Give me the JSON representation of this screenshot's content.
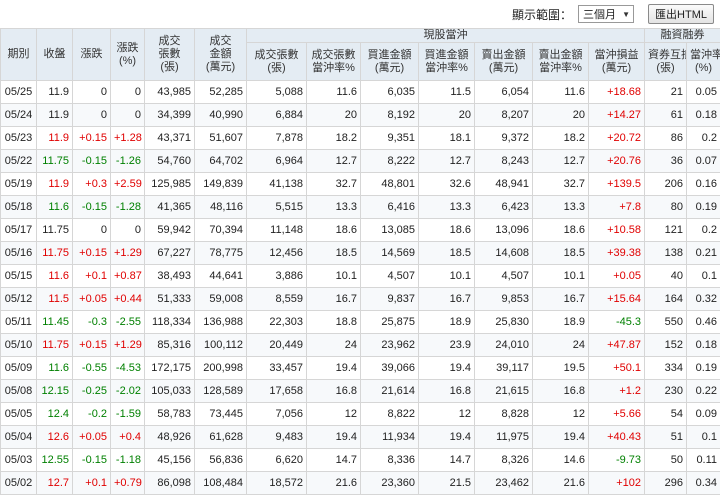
{
  "toolbar": {
    "range_label": "顯示範圍：",
    "range_value": "三個月",
    "export_label": "匯出HTML"
  },
  "colors": {
    "up": "#e00000",
    "down": "#008000",
    "header_bg": "#e4ecf3"
  },
  "groups": {
    "daytrade": "現股當沖",
    "margin": "融資融券"
  },
  "columns": {
    "date": "期別",
    "close": "收盤",
    "change": "漲跌",
    "pct": "漲跌(%)",
    "vol": "成交張數(張)",
    "amt": "成交金額(萬元)",
    "dt_vol": "成交張數(張)",
    "dt_vol_rate": "成交張數當沖率%",
    "buy_amt": "買進金額(萬元)",
    "buy_rate": "買進金額當沖率%",
    "sell_amt": "賣出金額(萬元)",
    "sell_rate": "賣出金額當沖率%",
    "pnl": "當沖損益(萬元)",
    "offset": "資券互抵(張)",
    "dt_rate": "當沖率(%)"
  },
  "rows": [
    {
      "date": "05/25",
      "close": "11.9",
      "change": "0",
      "pct": "0",
      "vol": "43,985",
      "amt": "52,285",
      "dt_vol": "5,088",
      "dt_vol_rate": "11.6",
      "buy_amt": "6,035",
      "buy_rate": "11.5",
      "sell_amt": "6,054",
      "sell_rate": "11.6",
      "pnl": "+18.68",
      "offset": "21",
      "dt_rate": "0.05",
      "dir": "flat",
      "pnl_dir": "pos"
    },
    {
      "date": "05/24",
      "close": "11.9",
      "change": "0",
      "pct": "0",
      "vol": "34,399",
      "amt": "40,990",
      "dt_vol": "6,884",
      "dt_vol_rate": "20",
      "buy_amt": "8,192",
      "buy_rate": "20",
      "sell_amt": "8,207",
      "sell_rate": "20",
      "pnl": "+14.27",
      "offset": "61",
      "dt_rate": "0.18",
      "dir": "flat",
      "pnl_dir": "pos"
    },
    {
      "date": "05/23",
      "close": "11.9",
      "change": "+0.15",
      "pct": "+1.28",
      "vol": "43,371",
      "amt": "51,607",
      "dt_vol": "7,878",
      "dt_vol_rate": "18.2",
      "buy_amt": "9,351",
      "buy_rate": "18.1",
      "sell_amt": "9,372",
      "sell_rate": "18.2",
      "pnl": "+20.72",
      "offset": "86",
      "dt_rate": "0.2",
      "dir": "pos",
      "pnl_dir": "pos"
    },
    {
      "date": "05/22",
      "close": "11.75",
      "change": "-0.15",
      "pct": "-1.26",
      "vol": "54,760",
      "amt": "64,702",
      "dt_vol": "6,964",
      "dt_vol_rate": "12.7",
      "buy_amt": "8,222",
      "buy_rate": "12.7",
      "sell_amt": "8,243",
      "sell_rate": "12.7",
      "pnl": "+20.76",
      "offset": "36",
      "dt_rate": "0.07",
      "dir": "neg",
      "pnl_dir": "pos"
    },
    {
      "date": "05/19",
      "close": "11.9",
      "change": "+0.3",
      "pct": "+2.59",
      "vol": "125,985",
      "amt": "149,839",
      "dt_vol": "41,138",
      "dt_vol_rate": "32.7",
      "buy_amt": "48,801",
      "buy_rate": "32.6",
      "sell_amt": "48,941",
      "sell_rate": "32.7",
      "pnl": "+139.5",
      "offset": "206",
      "dt_rate": "0.16",
      "dir": "pos",
      "pnl_dir": "pos"
    },
    {
      "date": "05/18",
      "close": "11.6",
      "change": "-0.15",
      "pct": "-1.28",
      "vol": "41,365",
      "amt": "48,116",
      "dt_vol": "5,515",
      "dt_vol_rate": "13.3",
      "buy_amt": "6,416",
      "buy_rate": "13.3",
      "sell_amt": "6,423",
      "sell_rate": "13.3",
      "pnl": "+7.8",
      "offset": "80",
      "dt_rate": "0.19",
      "dir": "neg",
      "pnl_dir": "pos"
    },
    {
      "date": "05/17",
      "close": "11.75",
      "change": "0",
      "pct": "0",
      "vol": "59,942",
      "amt": "70,394",
      "dt_vol": "11,148",
      "dt_vol_rate": "18.6",
      "buy_amt": "13,085",
      "buy_rate": "18.6",
      "sell_amt": "13,096",
      "sell_rate": "18.6",
      "pnl": "+10.58",
      "offset": "121",
      "dt_rate": "0.2",
      "dir": "flat",
      "pnl_dir": "pos"
    },
    {
      "date": "05/16",
      "close": "11.75",
      "change": "+0.15",
      "pct": "+1.29",
      "vol": "67,227",
      "amt": "78,775",
      "dt_vol": "12,456",
      "dt_vol_rate": "18.5",
      "buy_amt": "14,569",
      "buy_rate": "18.5",
      "sell_amt": "14,608",
      "sell_rate": "18.5",
      "pnl": "+39.38",
      "offset": "138",
      "dt_rate": "0.21",
      "dir": "pos",
      "pnl_dir": "pos"
    },
    {
      "date": "05/15",
      "close": "11.6",
      "change": "+0.1",
      "pct": "+0.87",
      "vol": "38,493",
      "amt": "44,641",
      "dt_vol": "3,886",
      "dt_vol_rate": "10.1",
      "buy_amt": "4,507",
      "buy_rate": "10.1",
      "sell_amt": "4,507",
      "sell_rate": "10.1",
      "pnl": "+0.05",
      "offset": "40",
      "dt_rate": "0.1",
      "dir": "pos",
      "pnl_dir": "pos"
    },
    {
      "date": "05/12",
      "close": "11.5",
      "change": "+0.05",
      "pct": "+0.44",
      "vol": "51,333",
      "amt": "59,008",
      "dt_vol": "8,559",
      "dt_vol_rate": "16.7",
      "buy_amt": "9,837",
      "buy_rate": "16.7",
      "sell_amt": "9,853",
      "sell_rate": "16.7",
      "pnl": "+15.64",
      "offset": "164",
      "dt_rate": "0.32",
      "dir": "pos",
      "pnl_dir": "pos"
    },
    {
      "date": "05/11",
      "close": "11.45",
      "change": "-0.3",
      "pct": "-2.55",
      "vol": "118,334",
      "amt": "136,988",
      "dt_vol": "22,303",
      "dt_vol_rate": "18.8",
      "buy_amt": "25,875",
      "buy_rate": "18.9",
      "sell_amt": "25,830",
      "sell_rate": "18.9",
      "pnl": "-45.3",
      "offset": "550",
      "dt_rate": "0.46",
      "dir": "neg",
      "pnl_dir": "neg"
    },
    {
      "date": "05/10",
      "close": "11.75",
      "change": "+0.15",
      "pct": "+1.29",
      "vol": "85,316",
      "amt": "100,112",
      "dt_vol": "20,449",
      "dt_vol_rate": "24",
      "buy_amt": "23,962",
      "buy_rate": "23.9",
      "sell_amt": "24,010",
      "sell_rate": "24",
      "pnl": "+47.87",
      "offset": "152",
      "dt_rate": "0.18",
      "dir": "pos",
      "pnl_dir": "pos"
    },
    {
      "date": "05/09",
      "close": "11.6",
      "change": "-0.55",
      "pct": "-4.53",
      "vol": "172,175",
      "amt": "200,998",
      "dt_vol": "33,457",
      "dt_vol_rate": "19.4",
      "buy_amt": "39,066",
      "buy_rate": "19.4",
      "sell_amt": "39,117",
      "sell_rate": "19.5",
      "pnl": "+50.1",
      "offset": "334",
      "dt_rate": "0.19",
      "dir": "neg",
      "pnl_dir": "pos"
    },
    {
      "date": "05/08",
      "close": "12.15",
      "change": "-0.25",
      "pct": "-2.02",
      "vol": "105,033",
      "amt": "128,589",
      "dt_vol": "17,658",
      "dt_vol_rate": "16.8",
      "buy_amt": "21,614",
      "buy_rate": "16.8",
      "sell_amt": "21,615",
      "sell_rate": "16.8",
      "pnl": "+1.2",
      "offset": "230",
      "dt_rate": "0.22",
      "dir": "neg",
      "pnl_dir": "pos"
    },
    {
      "date": "05/05",
      "close": "12.4",
      "change": "-0.2",
      "pct": "-1.59",
      "vol": "58,783",
      "amt": "73,445",
      "dt_vol": "7,056",
      "dt_vol_rate": "12",
      "buy_amt": "8,822",
      "buy_rate": "12",
      "sell_amt": "8,828",
      "sell_rate": "12",
      "pnl": "+5.66",
      "offset": "54",
      "dt_rate": "0.09",
      "dir": "neg",
      "pnl_dir": "pos"
    },
    {
      "date": "05/04",
      "close": "12.6",
      "change": "+0.05",
      "pct": "+0.4",
      "vol": "48,926",
      "amt": "61,628",
      "dt_vol": "9,483",
      "dt_vol_rate": "19.4",
      "buy_amt": "11,934",
      "buy_rate": "19.4",
      "sell_amt": "11,975",
      "sell_rate": "19.4",
      "pnl": "+40.43",
      "offset": "51",
      "dt_rate": "0.1",
      "dir": "pos",
      "pnl_dir": "pos"
    },
    {
      "date": "05/03",
      "close": "12.55",
      "change": "-0.15",
      "pct": "-1.18",
      "vol": "45,156",
      "amt": "56,836",
      "dt_vol": "6,620",
      "dt_vol_rate": "14.7",
      "buy_amt": "8,336",
      "buy_rate": "14.7",
      "sell_amt": "8,326",
      "sell_rate": "14.6",
      "pnl": "-9.73",
      "offset": "50",
      "dt_rate": "0.11",
      "dir": "neg",
      "pnl_dir": "neg"
    },
    {
      "date": "05/02",
      "close": "12.7",
      "change": "+0.1",
      "pct": "+0.79",
      "vol": "86,098",
      "amt": "108,484",
      "dt_vol": "18,572",
      "dt_vol_rate": "21.6",
      "buy_amt": "23,360",
      "buy_rate": "21.5",
      "sell_amt": "23,462",
      "sell_rate": "21.6",
      "pnl": "+102",
      "offset": "296",
      "dt_rate": "0.34",
      "dir": "pos",
      "pnl_dir": "pos"
    }
  ]
}
